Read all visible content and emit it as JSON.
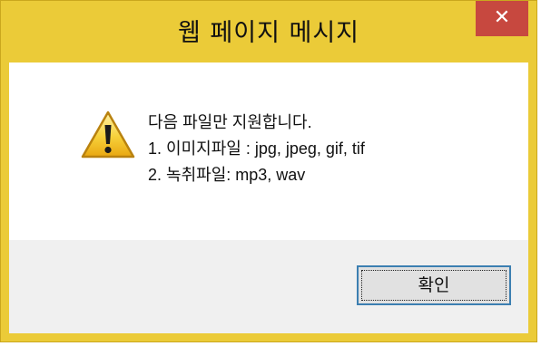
{
  "window": {
    "title": "웹 페이지 메시지",
    "close_glyph": "✕"
  },
  "dialog": {
    "icon": "warning-icon",
    "message_lines": [
      "다음 파일만 지원합니다.",
      "1. 이미지파일 : jpg, jpeg, gif, tif",
      "2. 녹취파일: mp3, wav"
    ],
    "ok_label": "확인"
  },
  "colors": {
    "frame": "#ebcb38",
    "close_button": "#c7483f",
    "footer": "#f0f0f0",
    "button_border": "#3c7fb1"
  }
}
